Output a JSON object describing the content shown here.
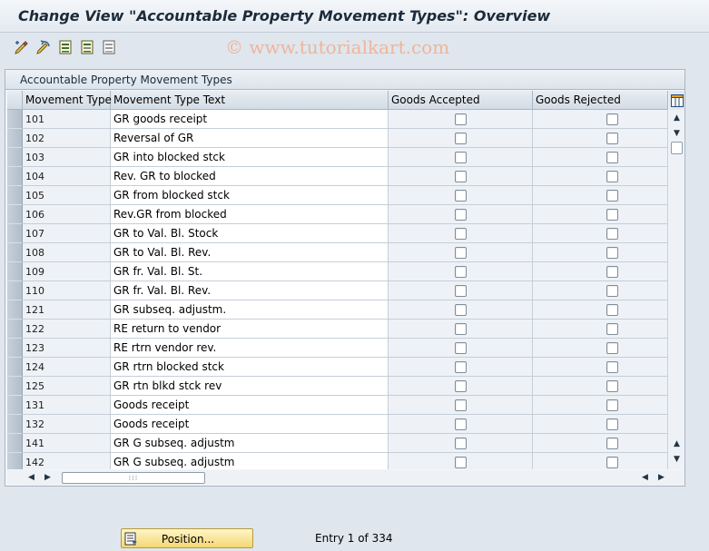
{
  "window": {
    "title": "Change View \"Accountable Property Movement Types\": Overview"
  },
  "toolbar": {
    "icons": [
      "edit-pencil-icon",
      "undo-icon",
      "select-all-icon",
      "select-block-icon",
      "deselect-all-icon"
    ]
  },
  "watermark": "© www.tutorialkart.com",
  "panel": {
    "title": "Accountable Property Movement Types"
  },
  "table": {
    "columns": [
      "Movement Type",
      "Movement Type Text",
      "Goods Accepted",
      "Goods Rejected"
    ],
    "rows": [
      {
        "type": "101",
        "text": "GR goods receipt",
        "accepted": false,
        "rejected": false
      },
      {
        "type": "102",
        "text": "Reversal of GR",
        "accepted": false,
        "rejected": false
      },
      {
        "type": "103",
        "text": "GR into blocked stck",
        "accepted": false,
        "rejected": false
      },
      {
        "type": "104",
        "text": "Rev. GR to blocked",
        "accepted": false,
        "rejected": false
      },
      {
        "type": "105",
        "text": "GR from blocked stck",
        "accepted": false,
        "rejected": false
      },
      {
        "type": "106",
        "text": "Rev.GR from blocked",
        "accepted": false,
        "rejected": false
      },
      {
        "type": "107",
        "text": "GR to Val. Bl. Stock",
        "accepted": false,
        "rejected": false
      },
      {
        "type": "108",
        "text": "GR to Val. Bl. Rev.",
        "accepted": false,
        "rejected": false
      },
      {
        "type": "109",
        "text": "GR fr. Val. Bl. St.",
        "accepted": false,
        "rejected": false
      },
      {
        "type": "110",
        "text": "GR fr. Val. Bl. Rev.",
        "accepted": false,
        "rejected": false
      },
      {
        "type": "121",
        "text": "GR subseq. adjustm.",
        "accepted": false,
        "rejected": false
      },
      {
        "type": "122",
        "text": "RE return to vendor",
        "accepted": false,
        "rejected": false
      },
      {
        "type": "123",
        "text": "RE rtrn vendor rev.",
        "accepted": false,
        "rejected": false
      },
      {
        "type": "124",
        "text": "GR rtrn blocked stck",
        "accepted": false,
        "rejected": false
      },
      {
        "type": "125",
        "text": "GR rtn blkd stck rev",
        "accepted": false,
        "rejected": false
      },
      {
        "type": "131",
        "text": "Goods receipt",
        "accepted": false,
        "rejected": false
      },
      {
        "type": "132",
        "text": "Goods receipt",
        "accepted": false,
        "rejected": false
      },
      {
        "type": "141",
        "text": "GR G subseq. adjustm",
        "accepted": false,
        "rejected": false
      },
      {
        "type": "142",
        "text": "GR G subseq. adjustm",
        "accepted": false,
        "rejected": false
      }
    ]
  },
  "footer": {
    "position_label": "Position...",
    "entry_text": "Entry 1 of 334"
  },
  "colors": {
    "background": "#dfe6ee",
    "button_yellow": "#f4d773",
    "watermark": "#f0b090"
  }
}
